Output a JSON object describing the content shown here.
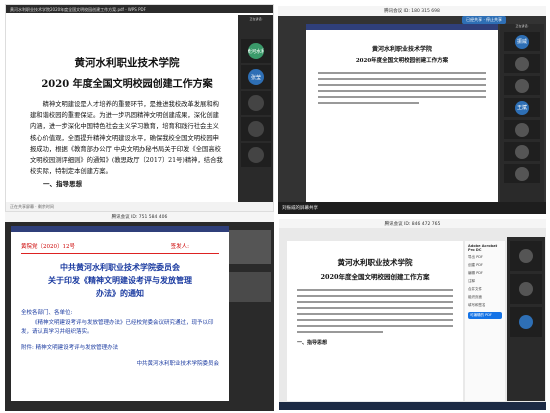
{
  "tl": {
    "titlebar": "黄河水利职业技术学院2020年度全国文明校园创建工作方案.pdf - WPS PDF",
    "speaker": "正在讲话:",
    "title1": "黄河水利职业技术学院",
    "title2": "2020 年度全国文明校园创建工作方案",
    "body": [
      "精神文明建设是人才培养的重要环节，是推进我校改革发展和构建和谐校园的重要保证。为进一步巩固精神文明创建成果，深化创建内涵，进一步深化中国特色社会主义学习教育，培育和践行社会主义核心价值观，全面提升精神文明建设水平，确保我校全国文明校园申报成功，根据《教育部办公厅 中央文明办秘书局关于印发《全国高校文明校园测评细则》的通知》(教思政厅〔2017〕21号)精神，结合我校实际，特制定本创建方案。"
    ],
    "section": "一、指导思想",
    "footer": "正在共享屏幕 · 剩余时间",
    "tiles": [
      {
        "label": "黄河水利",
        "color": "#3a9a6a"
      },
      {
        "label": "张莹",
        "color": "#2e6fb5"
      },
      {
        "label": "",
        "color": "#444"
      },
      {
        "label": "",
        "color": "#444"
      },
      {
        "label": "",
        "color": "#444"
      }
    ]
  },
  "tr": {
    "topbar": "腾讯会议 ID: 180 315 698",
    "btn": "已经共享 · 停止共享",
    "speaker": "正在讲话:",
    "title1": "黄河水利职业技术学院",
    "title2": "2020年度全国文明校园创建工作方案",
    "sharing": "刘振威的屏幕共享",
    "tiles": [
      {
        "label": "振威",
        "color": "#2e6fb5"
      },
      {
        "label": "",
        "color": "#555"
      },
      {
        "label": "",
        "color": "#555"
      },
      {
        "label": "王斌",
        "color": "#2e6fb5"
      },
      {
        "label": "",
        "color": "#555"
      },
      {
        "label": "",
        "color": "#555"
      },
      {
        "label": "",
        "color": "#555"
      }
    ]
  },
  "bl": {
    "topbar": "腾讯会议 ID: 751 584 406",
    "docno": "黄院党〔2020〕12号",
    "signer": "签发人:",
    "h1": "中共黄河水利职业技术学院委员会",
    "h2": "关于印发《精神文明建设考评与发放管理",
    "h3": "办法》的通知",
    "body": [
      "全校各部门、各单位:",
      "《精神文明建设考评与发放管理办法》已经校党委会议研究通过，现予以印发，请认真学习并组织落实。",
      "附件: 精神文明建设考评与发放管理办法",
      "中共黄河水利职业技术学院委员会"
    ]
  },
  "br": {
    "topbar": "腾讯会议 ID: 846 472 765",
    "title1": "黄河水利职业技术学院",
    "title2": "2020年度全国文明校园创建工作方案",
    "section": "一、指导思想",
    "menu": [
      "Adobe Acrobat Pro DC",
      "导出 PDF",
      "创建 PDF",
      "编辑 PDF",
      "注释",
      "合并文件",
      "组织页面",
      "填写和签名"
    ],
    "cta": "可编辑的 PDF",
    "tiles": [
      {
        "label": "",
        "color": "#555"
      },
      {
        "label": "",
        "color": "#555"
      },
      {
        "label": "",
        "color": "#2e6fb5"
      }
    ]
  }
}
